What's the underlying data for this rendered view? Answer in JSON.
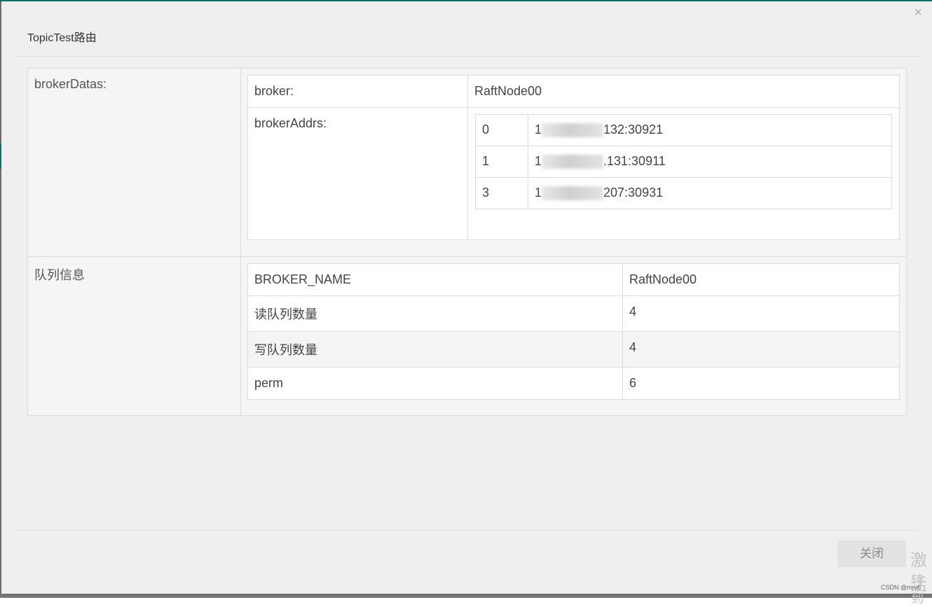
{
  "dialog": {
    "title": "TopicTest路由",
    "close_icon": "×",
    "close_button": "关闭"
  },
  "broker_datas": {
    "label": "brokerDatas:",
    "broker_label": "broker:",
    "broker_value": "RaftNode00",
    "addrs_label": "brokerAddrs:",
    "addrs": [
      {
        "index": "0",
        "prefix": "1",
        "suffix": "132:30921"
      },
      {
        "index": "1",
        "prefix": "1",
        "suffix": ".131:30911"
      },
      {
        "index": "3",
        "prefix": "1",
        "suffix": "207:30931"
      }
    ]
  },
  "queue_info": {
    "label": "队列信息",
    "rows": [
      {
        "key": "BROKER_NAME",
        "value": "RaftNode00"
      },
      {
        "key": "读队列数量",
        "value": "4"
      },
      {
        "key": "写队列数量",
        "value": "4"
      },
      {
        "key": "perm",
        "value": "6"
      }
    ]
  },
  "background": {
    "watermark_line1": "激活",
    "watermark_line2": "转到",
    "credit": "CSDN @mry6"
  },
  "colors": {
    "accent_teal": "#0e7f6f",
    "modal_bg": "#efefef",
    "button_bg": "#e2e2e2"
  }
}
